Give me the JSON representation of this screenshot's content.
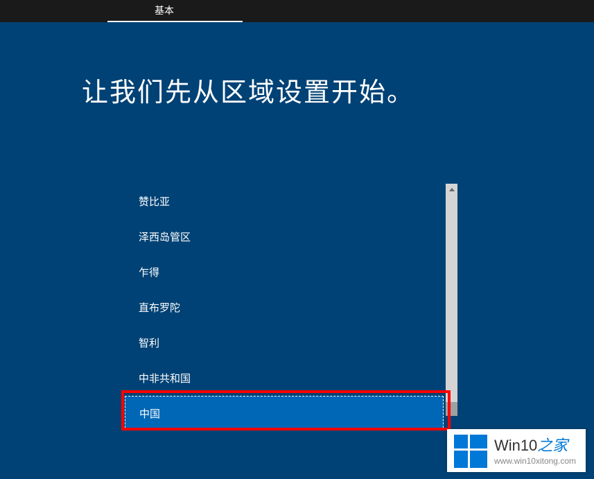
{
  "header": {
    "tab_label": "基本"
  },
  "main": {
    "heading": "让我们先从区域设置开始。"
  },
  "regions": {
    "items": [
      {
        "label": "赞比亚",
        "selected": false
      },
      {
        "label": "泽西岛管区",
        "selected": false
      },
      {
        "label": "乍得",
        "selected": false
      },
      {
        "label": "直布罗陀",
        "selected": false
      },
      {
        "label": "智利",
        "selected": false
      },
      {
        "label": "中非共和国",
        "selected": false
      },
      {
        "label": "中国",
        "selected": true
      }
    ]
  },
  "watermark": {
    "title_main": "Win10",
    "title_accent": "之家",
    "url": "www.win10xitong.com"
  }
}
